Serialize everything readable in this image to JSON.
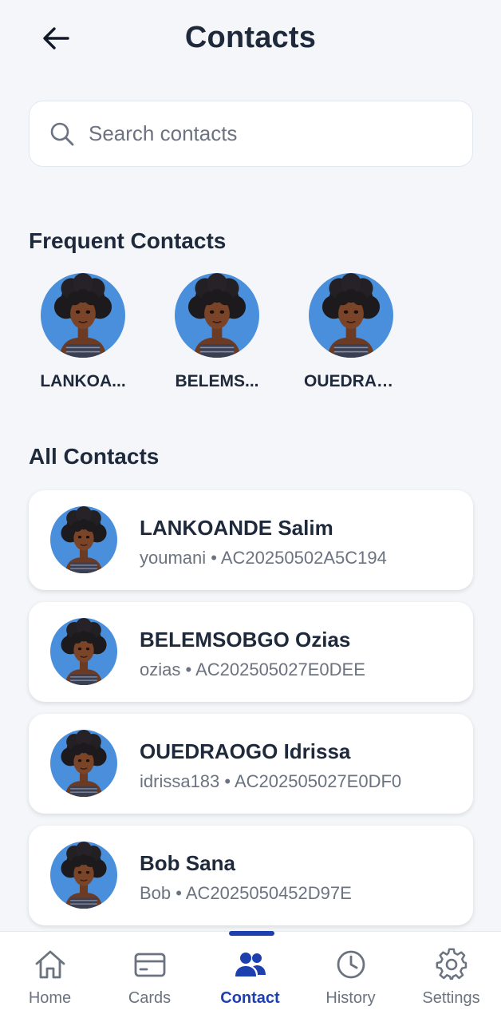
{
  "header": {
    "title": "Contacts"
  },
  "search": {
    "placeholder": "Search contacts"
  },
  "frequent": {
    "title": "Frequent Contacts",
    "items": [
      {
        "label": "LANKOA..."
      },
      {
        "label": "BELEMS..."
      },
      {
        "label": "OUEDRAO..."
      }
    ]
  },
  "all": {
    "title": "All Contacts",
    "contacts": [
      {
        "name": "LANKOANDE Salim",
        "username": "youmani",
        "account": "AC20250502A5C194",
        "sub": "youmani • AC20250502A5C194"
      },
      {
        "name": "BELEMSOBGO Ozias",
        "username": "ozias",
        "account": "AC202505027E0DEE",
        "sub": "ozias • AC202505027E0DEE"
      },
      {
        "name": "OUEDRAOGO Idrissa",
        "username": "idrissa183",
        "account": "AC202505027E0DF0",
        "sub": "idrissa183 • AC202505027E0DF0"
      },
      {
        "name": "Bob Sana",
        "username": "Bob",
        "account": "AC2025050452D97E",
        "sub": "Bob • AC2025050452D97E"
      }
    ]
  },
  "nav": {
    "items": [
      {
        "label": "Home",
        "icon": "home-icon"
      },
      {
        "label": "Cards",
        "icon": "card-icon"
      },
      {
        "label": "Contact",
        "icon": "contacts-icon",
        "active": true
      },
      {
        "label": "History",
        "icon": "clock-icon"
      },
      {
        "label": "Settings",
        "icon": "gear-icon"
      }
    ]
  },
  "colors": {
    "accent": "#1e40af",
    "avatar_bg": "#4a8fdc",
    "background": "#f4f6f9",
    "text_primary": "#1e293b",
    "text_secondary": "#6b7280"
  }
}
